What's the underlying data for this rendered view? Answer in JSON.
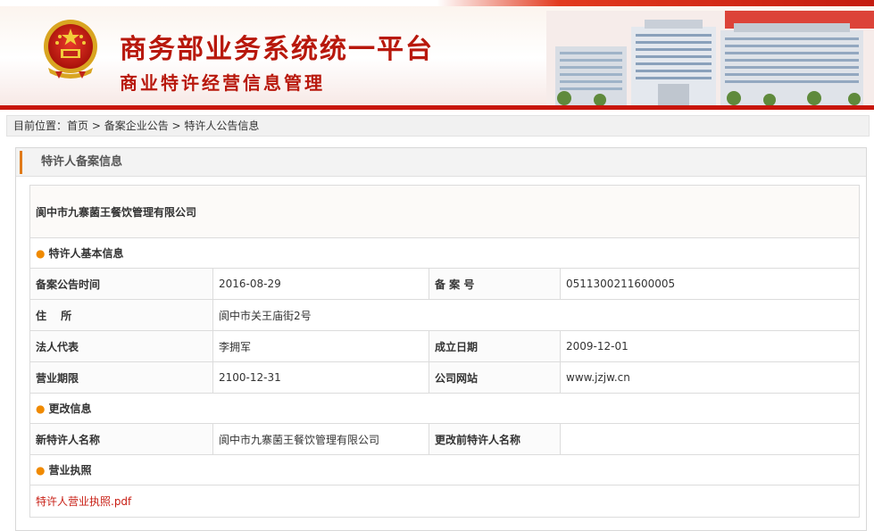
{
  "header": {
    "title": "商务部业务系统统一平台",
    "subtitle": "商业特许经营信息管理",
    "emblem_icon": "national-emblem-icon",
    "building_image": "ministry-building-image"
  },
  "breadcrumb": {
    "prefix": "目前位置：",
    "home": "首页",
    "sep1": " > ",
    "level1": "备案企业公告",
    "sep2": " > ",
    "current": "特许人公告信息"
  },
  "panel": {
    "title": "特许人备案信息"
  },
  "company": {
    "name": "阆中市九寨菌王餐饮管理有限公司"
  },
  "basic_info": {
    "section_title": "特许人基本信息",
    "rows": [
      {
        "label1": "备案公告时间",
        "value1": "2016-08-29",
        "label2": "备 案 号",
        "value2": "0511300211600005"
      },
      {
        "label1": "住　 所",
        "value1": "阆中市关王庙街2号"
      },
      {
        "label1": "法人代表",
        "value1": "李拥军",
        "label2": "成立日期",
        "value2": "2009-12-01"
      },
      {
        "label1": "营业期限",
        "value1": "2100-12-31",
        "label2": "公司网站",
        "value2": "www.jzjw.cn"
      }
    ]
  },
  "change_info": {
    "section_title": "更改信息",
    "new_name_label": "新特许人名称",
    "new_name_value": "阆中市九寨菌王餐饮管理有限公司",
    "old_name_label": "更改前特许人名称",
    "old_name_value": ""
  },
  "license": {
    "section_title": "营业执照",
    "file_link": "特许人营业执照.pdf"
  },
  "colors": {
    "brand_red": "#b8180c",
    "accent_orange": "#e07a1a",
    "link_red": "#c81e14"
  }
}
